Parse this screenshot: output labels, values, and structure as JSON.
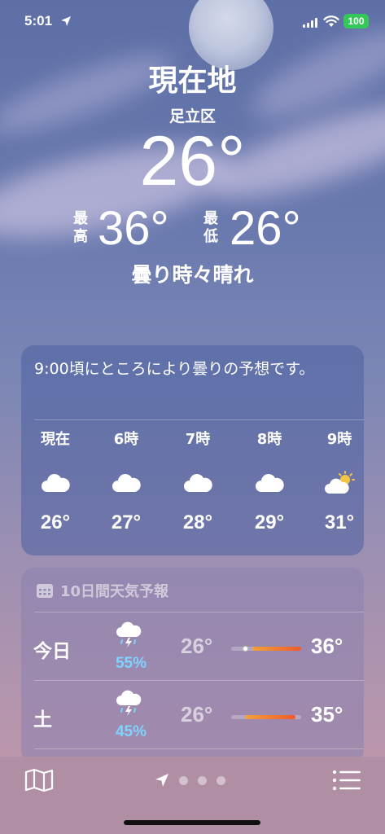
{
  "status_bar": {
    "time": "5:01",
    "battery": "100",
    "icons": [
      "location-arrow-icon",
      "cellular-signal-icon",
      "wifi-icon",
      "battery-icon"
    ]
  },
  "header": {
    "location": "現在地",
    "sublocation": "足立区",
    "current_temp": "26°",
    "high_label": "最高",
    "high": "36°",
    "low_label": "最低",
    "low": "26°",
    "condition": "曇り時々晴れ"
  },
  "hourly": {
    "summary": "9:00頃にところにより曇りの予想です。",
    "hours": [
      {
        "label": "現在",
        "icon": "cloud-icon",
        "temp": "26°"
      },
      {
        "label": "6時",
        "icon": "cloud-icon",
        "temp": "27°"
      },
      {
        "label": "7時",
        "icon": "cloud-icon",
        "temp": "28°"
      },
      {
        "label": "8時",
        "icon": "cloud-icon",
        "temp": "29°"
      },
      {
        "label": "9時",
        "icon": "partly-sunny-icon",
        "temp": "31°"
      }
    ]
  },
  "daily": {
    "title": "10日間天気予報",
    "icon": "calendar-icon",
    "days": [
      {
        "day": "今日",
        "icon": "thunderstorm-icon",
        "precip": "55%",
        "low": "26°",
        "high": "36°",
        "range_start": 0.3,
        "range_end": 1.0,
        "current_pos": 0.2
      },
      {
        "day": "土",
        "icon": "thunderstorm-icon",
        "precip": "45%",
        "low": "26°",
        "high": "35°",
        "range_start": 0.2,
        "range_end": 0.92
      }
    ]
  },
  "bottom_bar": {
    "icons": [
      "map-icon",
      "location-arrow-icon",
      "page-dot",
      "page-dot",
      "page-dot",
      "list-icon"
    ]
  },
  "colors": {
    "battery_green": "#34c759",
    "precip_blue": "#7fd3ff",
    "bar_gradient_start": "#f2a23c",
    "bar_gradient_end": "#ef5a2c",
    "sun_yellow": "#f6c445"
  }
}
